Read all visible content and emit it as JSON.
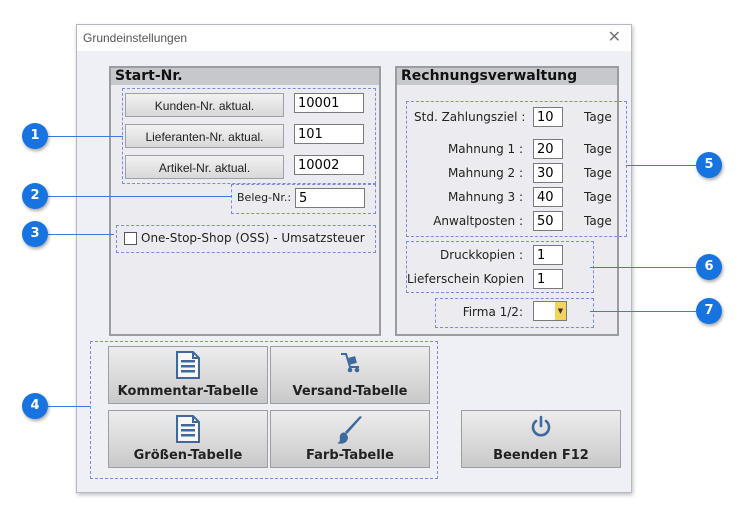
{
  "window": {
    "title": "Grundeinstellungen",
    "close": "✕"
  },
  "start": {
    "header": "Start-Nr.",
    "kunden_label": "Kunden-Nr. aktual.",
    "kunden_value": "10001",
    "lieferanten_label": "Lieferanten-Nr. aktual.",
    "lieferanten_value": "101",
    "artikel_label": "Artikel-Nr. aktual.",
    "artikel_value": "10002",
    "beleg_label": "Beleg-Nr.:",
    "beleg_value": "5",
    "oss_label": "One-Stop-Shop (OSS) - Umsatzsteuer"
  },
  "rechnung": {
    "header": "Rechnungsverwaltung",
    "zahlungsziel_label": "Std. Zahlungsziel :",
    "zahlungsziel_value": "10",
    "mahnung1_label": "Mahnung 1 :",
    "mahnung1_value": "20",
    "mahnung2_label": "Mahnung 2 :",
    "mahnung2_value": "30",
    "mahnung3_label": "Mahnung 3 :",
    "mahnung3_value": "40",
    "anwalt_label": "Anwaltposten :",
    "anwalt_value": "50",
    "tage": "Tage",
    "druck_label": "Druckkopien :",
    "druck_value": "1",
    "liefer_label": "Lieferschein Kopien",
    "liefer_value": "1",
    "firma_label": "Firma 1/2:",
    "firma_value": ""
  },
  "buttons": {
    "kommentar": "Kommentar-Tabelle",
    "versand": "Versand-Tabelle",
    "groessen": "Größen-Tabelle",
    "farb": "Farb-Tabelle",
    "beenden": "Beenden  F12"
  },
  "badges": [
    "1",
    "2",
    "3",
    "4",
    "5",
    "6",
    "7"
  ],
  "colors": {
    "badge": "#1673e0",
    "icon": "#3d6a9e"
  }
}
